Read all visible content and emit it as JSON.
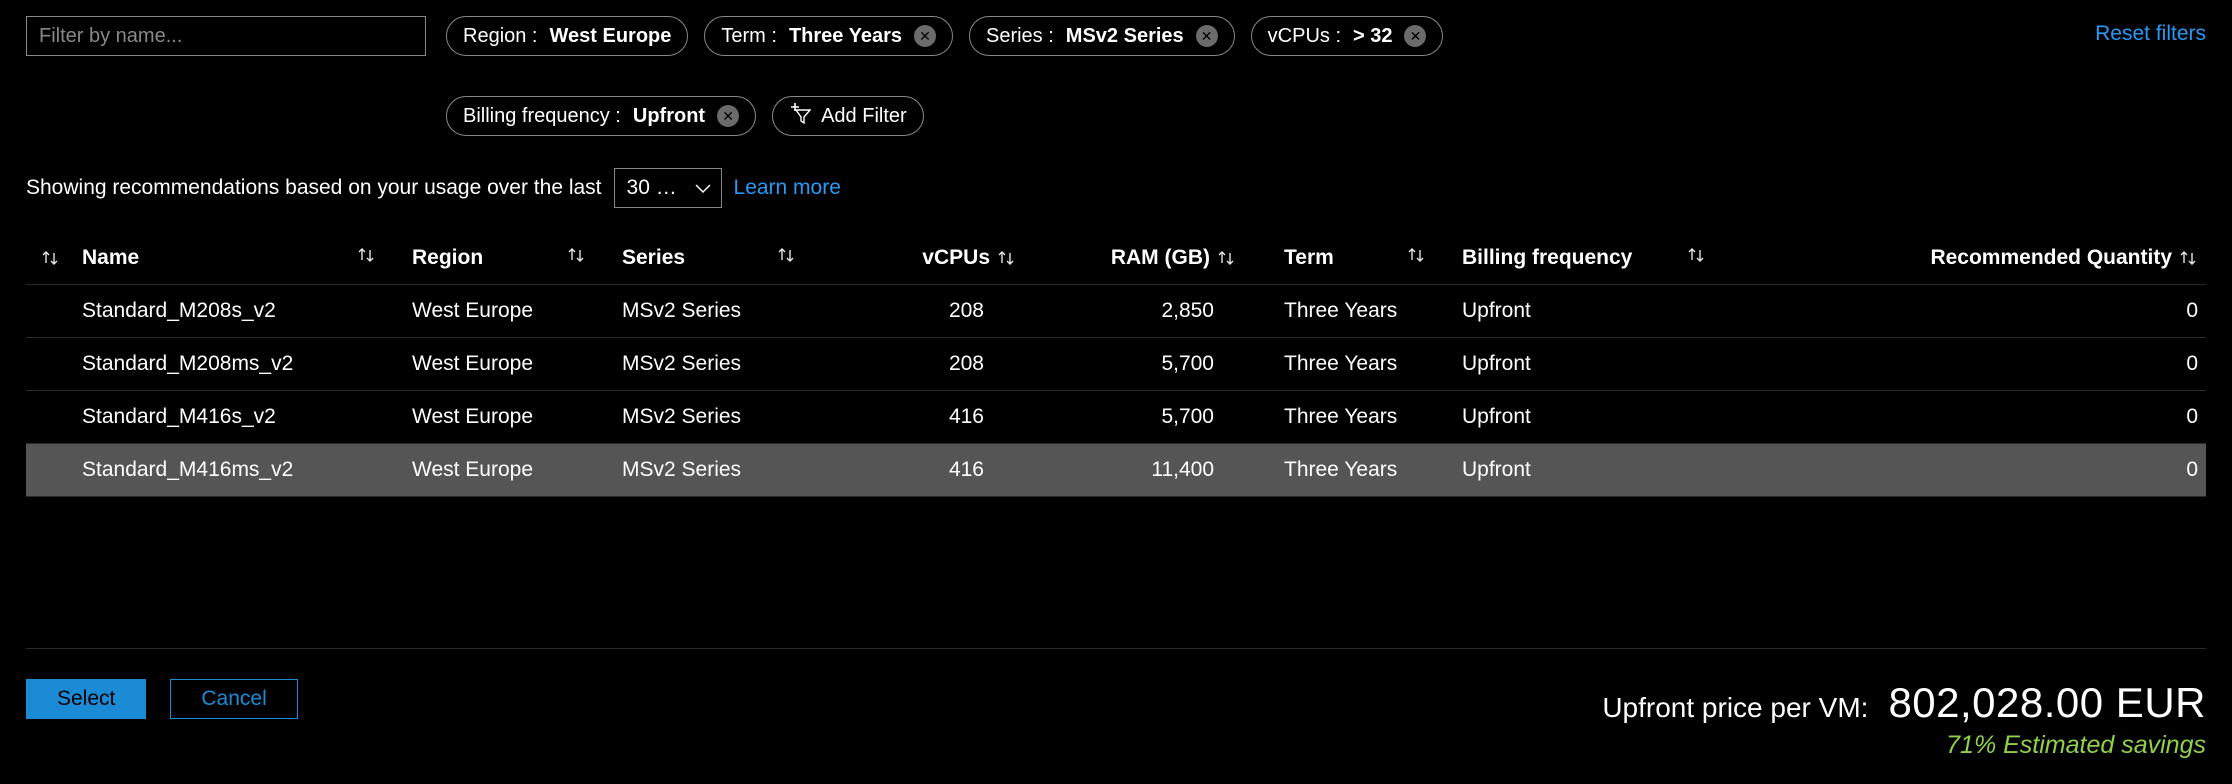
{
  "filters": {
    "name_placeholder": "Filter by name...",
    "chips": [
      {
        "label": "Region : ",
        "value": "West Europe",
        "closable": false
      },
      {
        "label": "Term : ",
        "value": "Three Years",
        "closable": true
      },
      {
        "label": "Series : ",
        "value": "MSv2 Series",
        "closable": true
      },
      {
        "label": "vCPUs : ",
        "value": "> 32",
        "closable": true
      },
      {
        "label": "Billing frequency : ",
        "value": "Upfront",
        "closable": true
      }
    ],
    "add_filter_label": "Add Filter",
    "reset_label": "Reset filters"
  },
  "recommendation": {
    "text": "Showing recommendations based on your usage over the last",
    "period_value": "30 d…",
    "learn_more": "Learn more"
  },
  "table": {
    "columns": {
      "name": "Name",
      "region": "Region",
      "series": "Series",
      "vcpus": "vCPUs",
      "ram": "RAM (GB)",
      "term": "Term",
      "billing": "Billing frequency",
      "qty": "Recommended Quantity"
    },
    "rows": [
      {
        "name": "Standard_M208s_v2",
        "region": "West Europe",
        "series": "MSv2 Series",
        "vcpus": "208",
        "ram": "2,850",
        "term": "Three Years",
        "billing": "Upfront",
        "qty": "0",
        "hovered": false
      },
      {
        "name": "Standard_M208ms_v2",
        "region": "West Europe",
        "series": "MSv2 Series",
        "vcpus": "208",
        "ram": "5,700",
        "term": "Three Years",
        "billing": "Upfront",
        "qty": "0",
        "hovered": false
      },
      {
        "name": "Standard_M416s_v2",
        "region": "West Europe",
        "series": "MSv2 Series",
        "vcpus": "416",
        "ram": "5,700",
        "term": "Three Years",
        "billing": "Upfront",
        "qty": "0",
        "hovered": false
      },
      {
        "name": "Standard_M416ms_v2",
        "region": "West Europe",
        "series": "MSv2 Series",
        "vcpus": "416",
        "ram": "11,400",
        "term": "Three Years",
        "billing": "Upfront",
        "qty": "0",
        "hovered": true
      }
    ]
  },
  "footer": {
    "select_label": "Select",
    "cancel_label": "Cancel",
    "price_label": "Upfront price per VM:",
    "price_value": "802,028.00 EUR",
    "savings": "71% Estimated savings"
  }
}
